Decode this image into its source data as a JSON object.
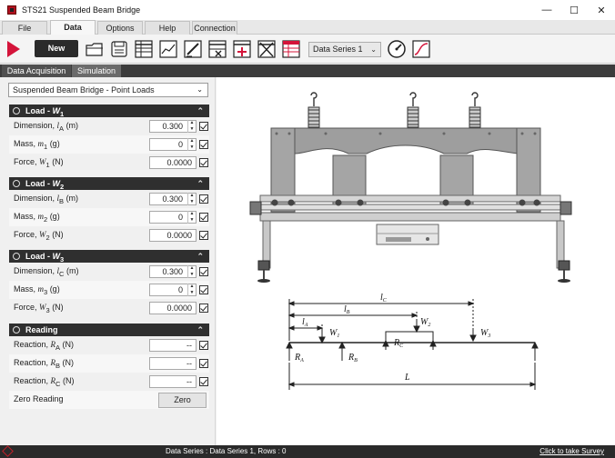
{
  "window": {
    "title": "STS21 Suspended Beam Bridge",
    "min_icon": "minimize-icon",
    "max_icon": "maximize-icon",
    "close_icon": "close-icon"
  },
  "menu": {
    "tabs": [
      "File",
      "Data",
      "Options",
      "Help",
      "Connection"
    ],
    "active": "Data"
  },
  "toolbar": {
    "new_label": "New",
    "data_series_value": "Data Series 1",
    "icons": [
      "play-icon",
      "open-folder-icon",
      "save-icon",
      "table-icon",
      "line-chart-icon",
      "edit-icon",
      "delete-row-icon",
      "add-row-icon",
      "clear-table-icon",
      "table-settings-icon",
      "gauge-icon",
      "curve-icon"
    ]
  },
  "subtabs": {
    "tab1": "Data Acquisition",
    "tab2": "Simulation",
    "active": "Simulation"
  },
  "experiment_select": "Suspended Beam Bridge - Point Loads",
  "load1": {
    "header": "Load - ",
    "header_sym": "W",
    "header_sub": "1",
    "dimension_label": "Dimension, ",
    "dimension_sym": "l",
    "dimension_sub": "A",
    "dimension_unit": " (m)",
    "dimension_value": "0.300",
    "mass_label": "Mass, ",
    "mass_sym": "m",
    "mass_sub": "1",
    "mass_unit": " (g)",
    "mass_value": "0",
    "force_label": "Force, ",
    "force_sym": "W",
    "force_sub": "1",
    "force_unit": " (N)",
    "force_value": "0.0000"
  },
  "load2": {
    "header": "Load - ",
    "header_sym": "W",
    "header_sub": "2",
    "dimension_label": "Dimension, ",
    "dimension_sym": "l",
    "dimension_sub": "B",
    "dimension_unit": " (m)",
    "dimension_value": "0.300",
    "mass_label": "Mass, ",
    "mass_sym": "m",
    "mass_sub": "2",
    "mass_unit": " (g)",
    "mass_value": "0",
    "force_label": "Force, ",
    "force_sym": "W",
    "force_sub": "2",
    "force_unit": " (N)",
    "force_value": "0.0000"
  },
  "load3": {
    "header": "Load - ",
    "header_sym": "W",
    "header_sub": "3",
    "dimension_label": "Dimension, ",
    "dimension_sym": "l",
    "dimension_sub": "C",
    "dimension_unit": " (m)",
    "dimension_value": "0.300",
    "mass_label": "Mass, ",
    "mass_sym": "m",
    "mass_sub": "3",
    "mass_unit": " (g)",
    "mass_value": "0",
    "force_label": "Force, ",
    "force_sym": "W",
    "force_sub": "3",
    "force_unit": " (N)",
    "force_value": "0.0000"
  },
  "reading": {
    "header": "Reading",
    "ra_label": "Reaction, ",
    "ra_sym": "R",
    "ra_sub": "A",
    "ra_unit": " (N)",
    "ra_value": "--",
    "rb_label": "Reaction, ",
    "rb_sym": "R",
    "rb_sub": "B",
    "rb_unit": " (N)",
    "rb_value": "--",
    "rc_label": "Reaction, ",
    "rc_sym": "R",
    "rc_sub": "C",
    "rc_unit": " (N)",
    "rc_value": "--",
    "zero_label": "Zero Reading",
    "zero_button": "Zero"
  },
  "diagram": {
    "lc": "l",
    "lc_sub": "C",
    "lb": "l",
    "lb_sub": "B",
    "la": "l",
    "la_sub": "A",
    "w1": "W",
    "w1_sub": "1",
    "w2": "W",
    "w2_sub": "2",
    "w3": "W",
    "w3_sub": "3",
    "rc": "R",
    "rc_sub": "C",
    "ra": "R",
    "ra_sub": "A",
    "rb": "R",
    "rb_sub": "B",
    "L": "L"
  },
  "status": {
    "text": "Data Series : Data Series 1,  Rows : 0",
    "survey": "Click to take Survey"
  },
  "colors": {
    "accent_red": "#d4143a",
    "header_dark": "#2f2f2f",
    "apparatus_grey": "#9a9a9a"
  }
}
